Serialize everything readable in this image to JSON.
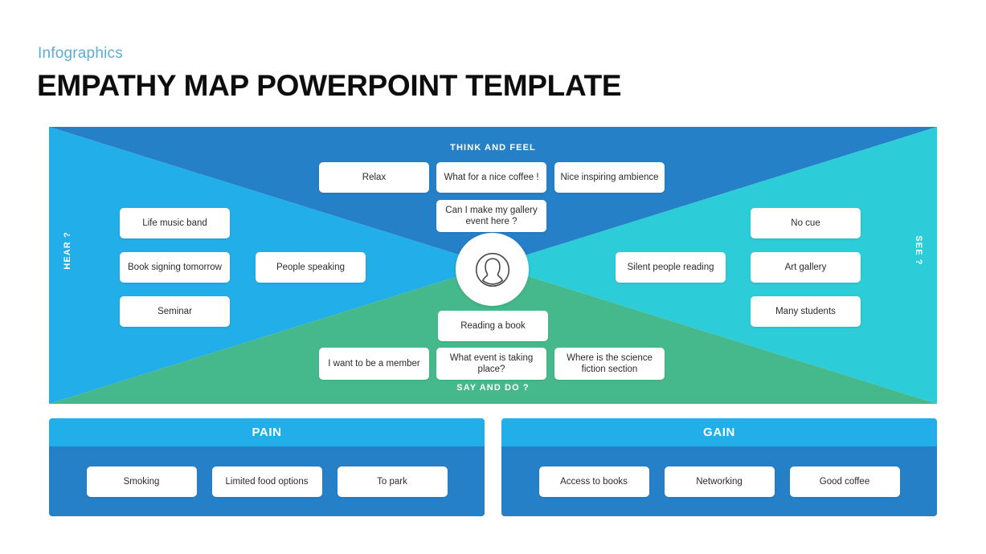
{
  "header": {
    "eyebrow": "Infographics",
    "title": "EMPATHY MAP POWERPOINT TEMPLATE"
  },
  "colors": {
    "eyebrow": "#5badd6",
    "quadrant_think_feel": "#2680c8",
    "quadrant_hear": "#22aee8",
    "quadrant_see": "#2cccd8",
    "quadrant_say_do": "#46b98c",
    "panel_header": "#22aee8",
    "panel_body": "#2680c8",
    "note_background": "#ffffff",
    "note_text": "#2b2b2b"
  },
  "map": {
    "center_icon": "user-avatar-icon",
    "quadrants": {
      "think_feel": {
        "label": "THINK  AND FEEL",
        "notes": [
          "Relax",
          "What for a nice coffee !",
          "Nice inspiring ambience",
          "Can I make my gallery event here ?"
        ]
      },
      "hear": {
        "label": "HEAR ?",
        "notes": [
          "Life music band",
          "Book signing tomorrow",
          "Seminar",
          "People speaking"
        ]
      },
      "see": {
        "label": "SEE ?",
        "notes": [
          "No cue",
          "Art gallery",
          "Many students",
          "Silent people reading"
        ]
      },
      "say_do": {
        "label": "SAY AND DO ?",
        "notes": [
          "Reading a book",
          "I want to be a member",
          "What event is taking place?",
          "Where is the science fiction section"
        ]
      }
    }
  },
  "panels": [
    {
      "title": "PAIN",
      "items": [
        "Smoking",
        "Limited food options",
        "To park"
      ]
    },
    {
      "title": "GAIN",
      "items": [
        "Access to books",
        "Networking",
        "Good coffee"
      ]
    }
  ]
}
